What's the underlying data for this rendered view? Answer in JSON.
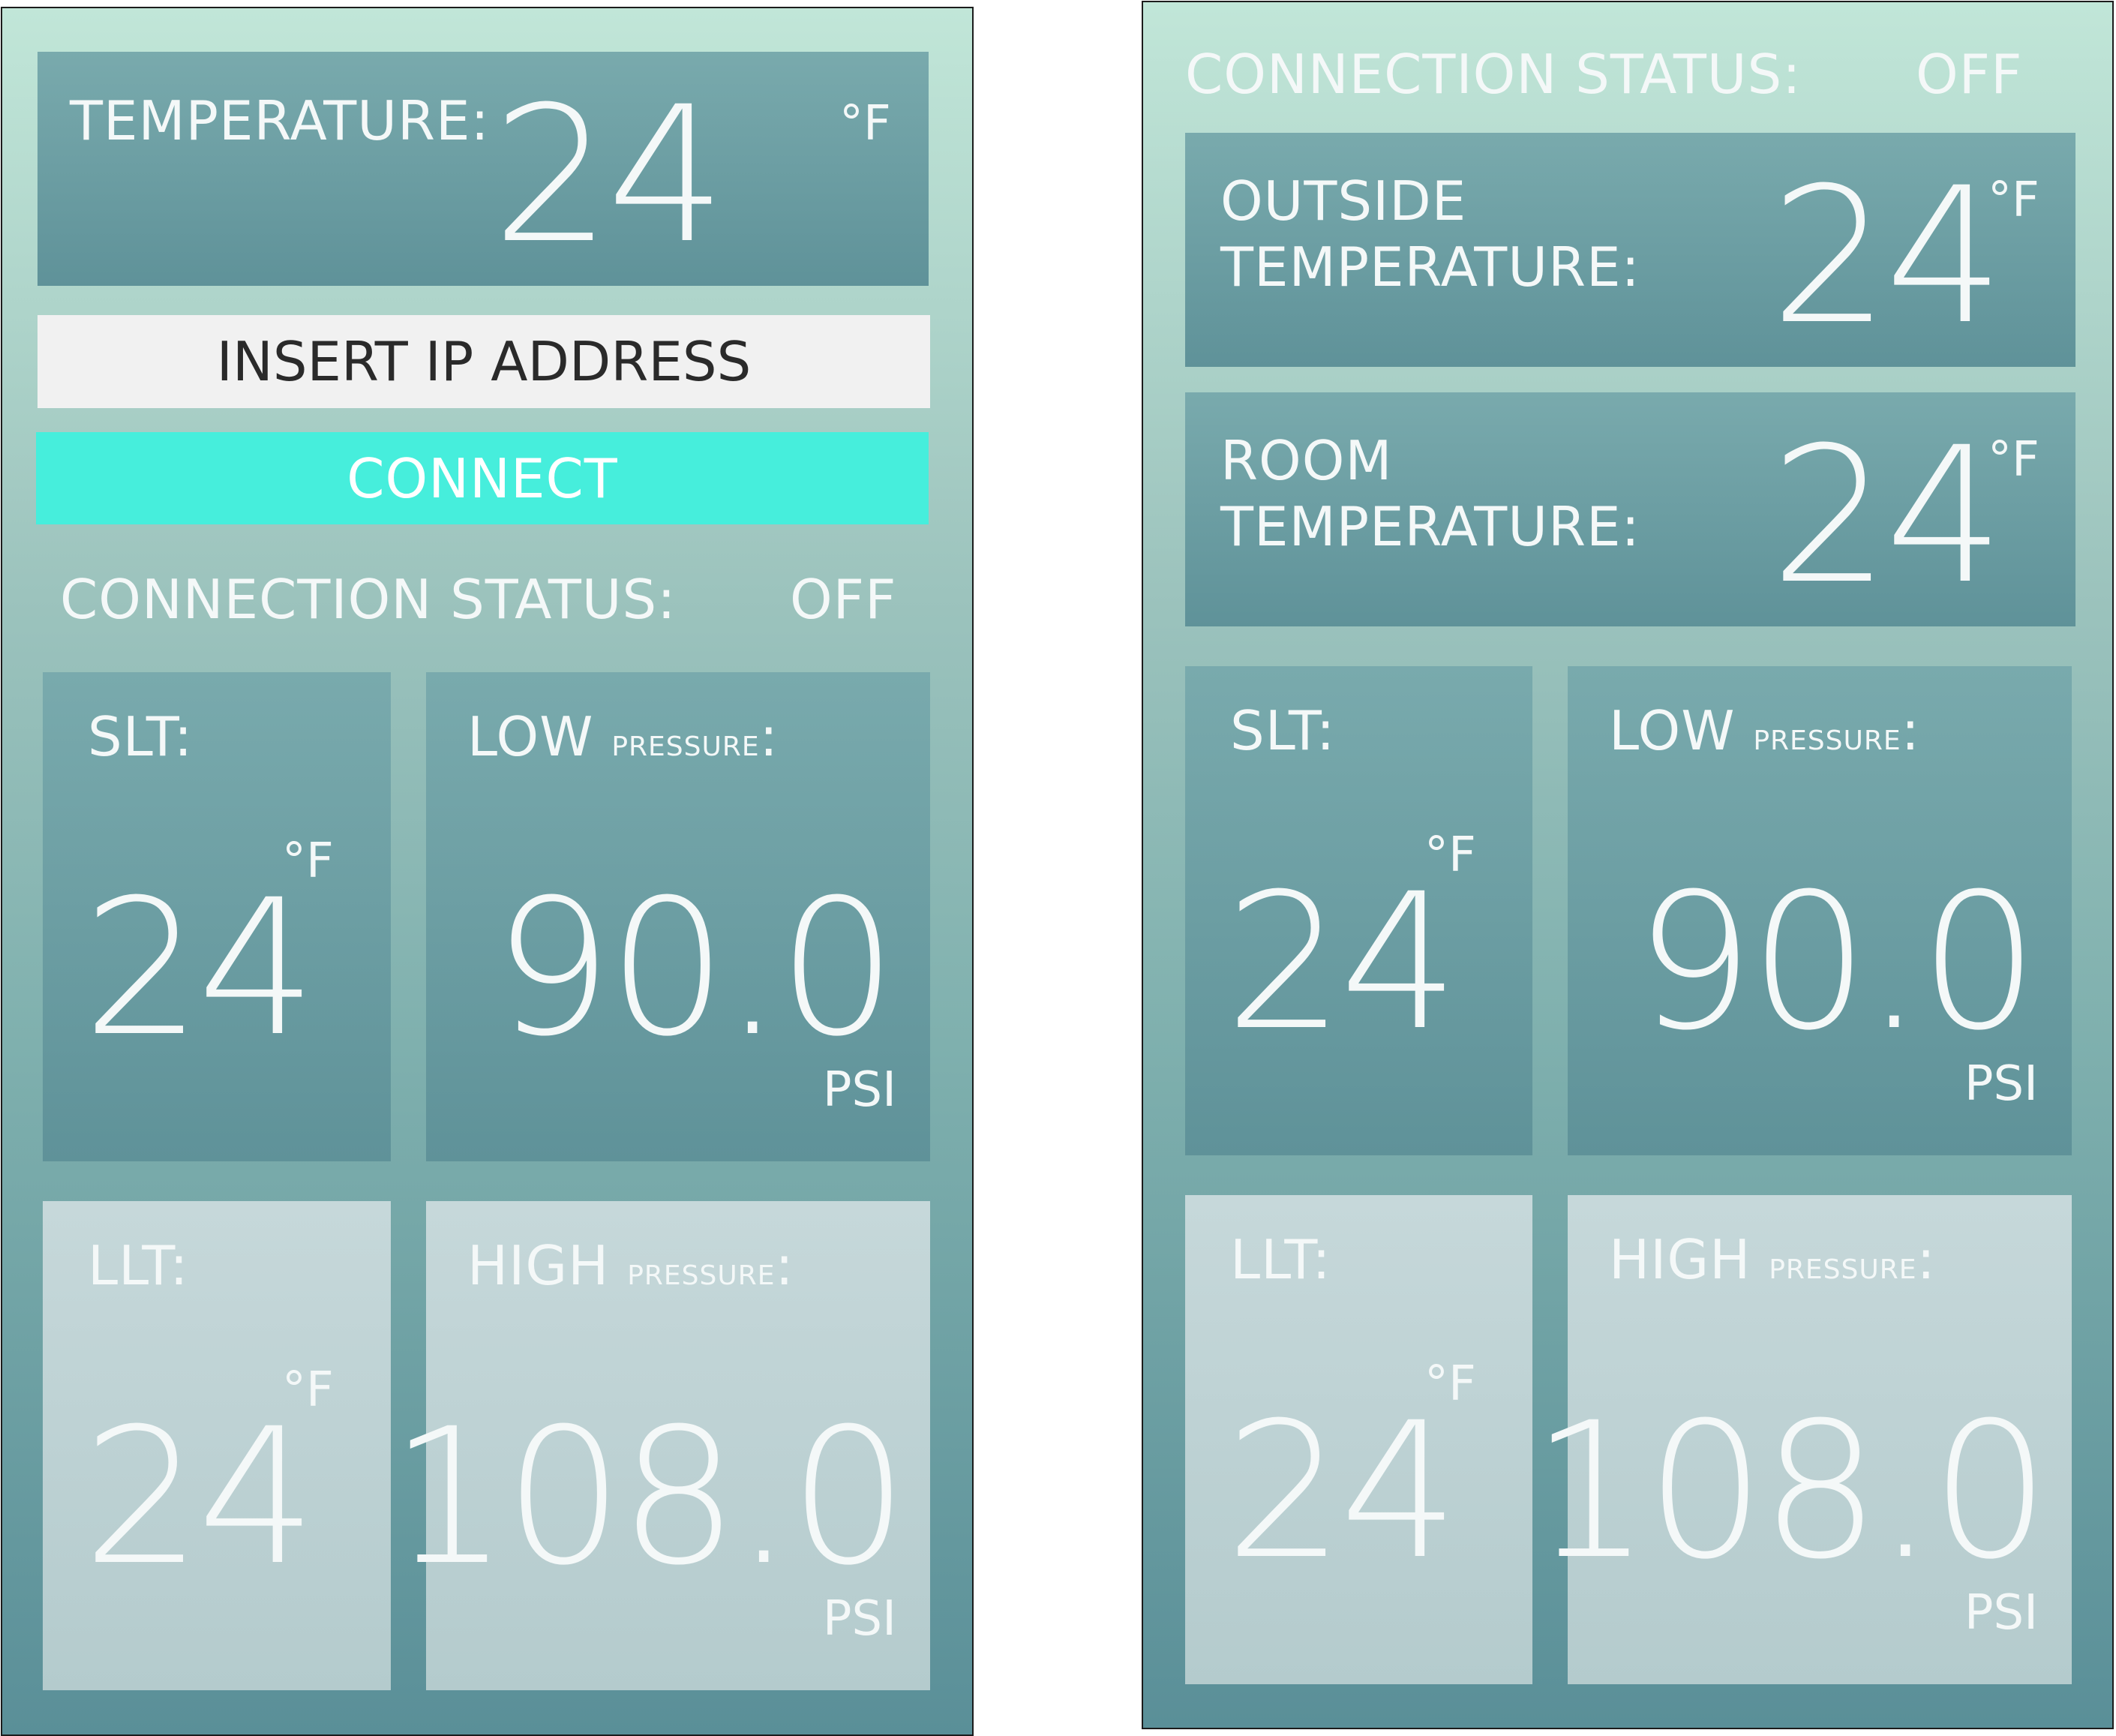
{
  "left_screen": {
    "temperature": {
      "label": "TEMPERATURE:",
      "value": "24",
      "unit": "°F"
    },
    "ip_input": {
      "placeholder": "INSERT IP ADDRESS"
    },
    "connect_button": {
      "label": "CONNECT"
    },
    "connection_status": {
      "label": "CONNECTION STATUS:",
      "value": "OFF"
    },
    "slt": {
      "label": "SLT:",
      "value": "24",
      "unit": "°F"
    },
    "low_pressure": {
      "label": "LOW",
      "label_small": "PRESSURE",
      "colon": ":",
      "value": "90.0",
      "unit": "PSI"
    },
    "llt": {
      "label": "LLT:",
      "value": "24",
      "unit": "°F"
    },
    "high_pressure": {
      "label": "HIGH",
      "label_small": "PRESSURE",
      "colon": ":",
      "value": "108.0",
      "unit": "PSI"
    }
  },
  "right_screen": {
    "connection_status": {
      "label": "CONNECTION STATUS:",
      "value": "OFF"
    },
    "outside_temperature": {
      "label_line1": "OUTSIDE",
      "label_line2": "TEMPERATURE:",
      "value": "24",
      "unit": "°F"
    },
    "room_temperature": {
      "label_line1": "ROOM",
      "label_line2": "TEMPERATURE:",
      "value": "24",
      "unit": "°F"
    },
    "slt": {
      "label": "SLT:",
      "value": "24",
      "unit": "°F"
    },
    "low_pressure": {
      "label": "LOW",
      "label_small": "PRESSURE",
      "colon": ":",
      "value": "90.0",
      "unit": "PSI"
    },
    "llt": {
      "label": "LLT:",
      "value": "24",
      "unit": "°F"
    },
    "high_pressure": {
      "label": "HIGH",
      "label_small": "PRESSURE",
      "colon": ":",
      "value": "108.0",
      "unit": "PSI"
    }
  },
  "colors": {
    "connect_button": "#46eedc",
    "input_background": "#f1f1f1",
    "tile_dark": "#6a9ba1",
    "tile_light": "#bdd2d4",
    "gradient_top": "#c1e6d8",
    "gradient_bottom": "#5a8f98"
  }
}
